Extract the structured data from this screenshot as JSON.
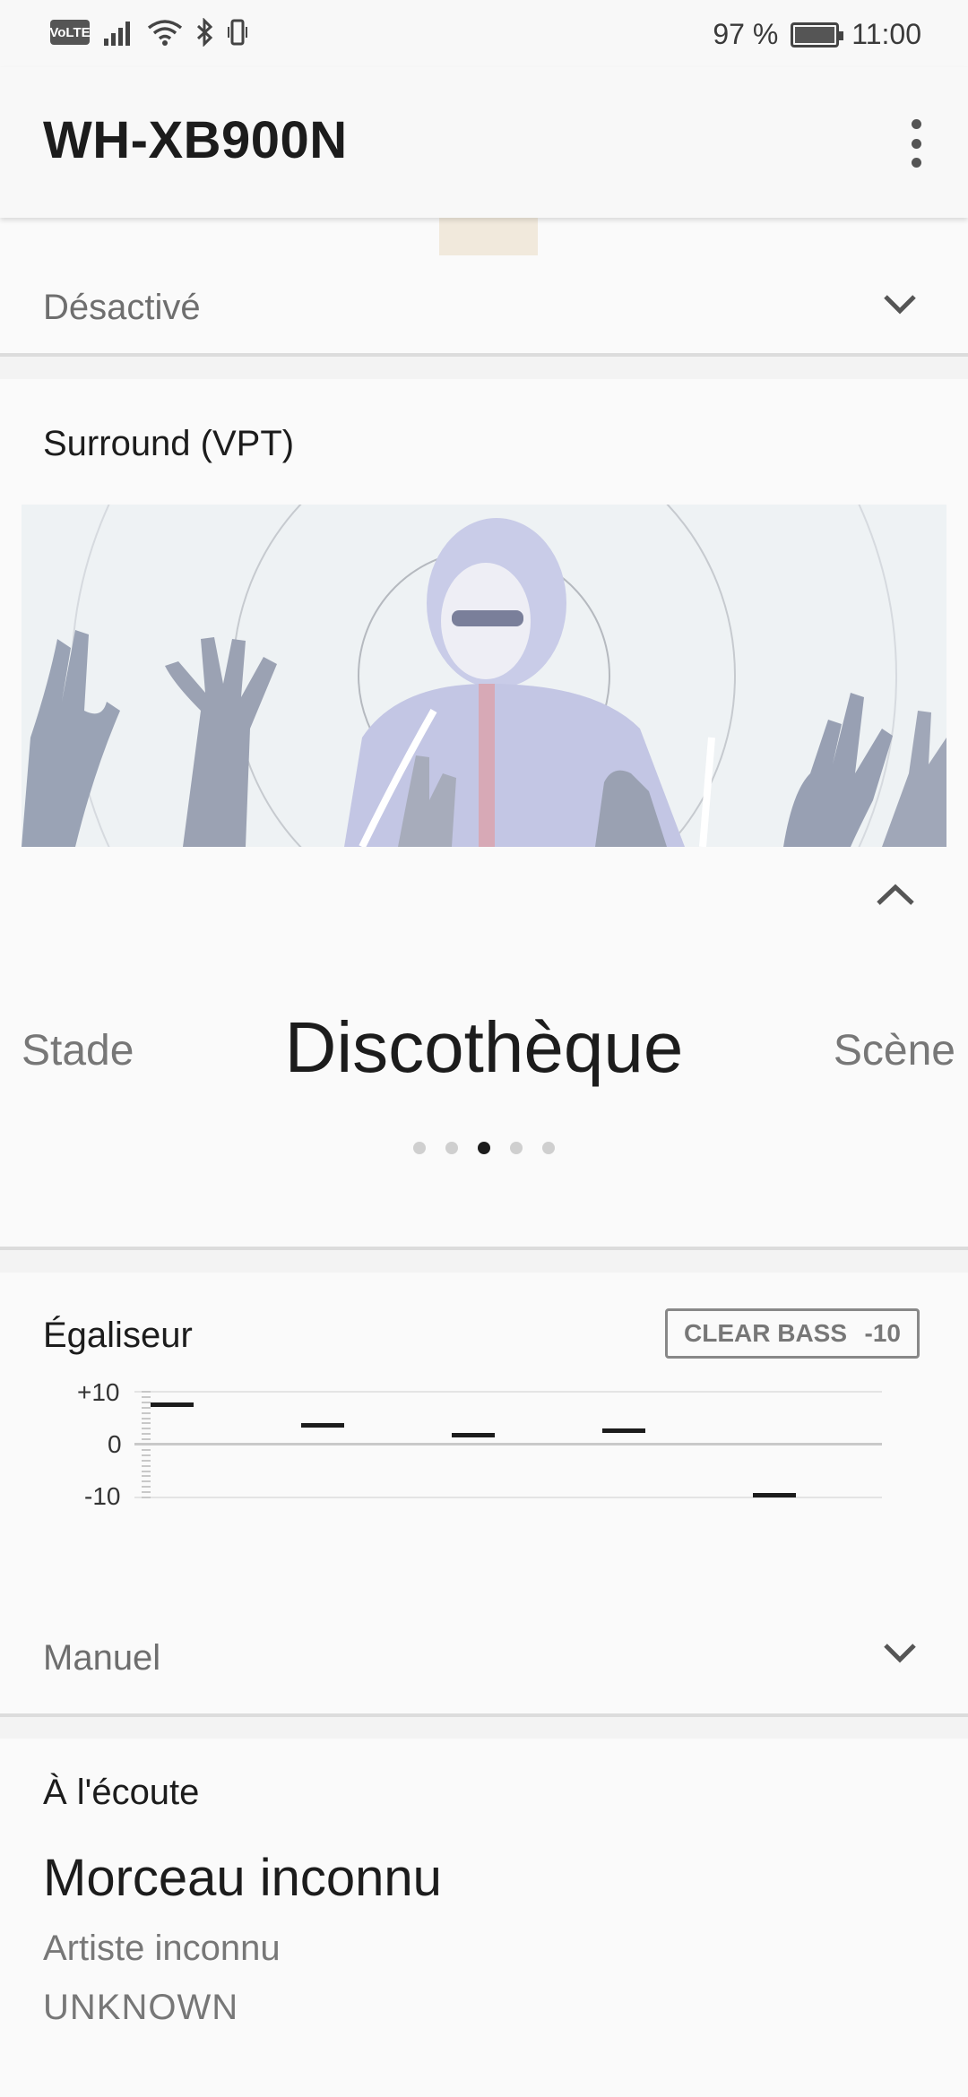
{
  "status_bar": {
    "volte": "VoLTE",
    "battery_percent": "97 %",
    "time": "11:00",
    "icons": [
      "volte-icon",
      "signal-icon",
      "wifi-icon",
      "bluetooth-icon",
      "vibrate-icon",
      "battery-icon"
    ]
  },
  "app_bar": {
    "title": "WH-XB900N",
    "menu_icon": "more-vert-icon"
  },
  "noise_card": {
    "selected_value": "Désactivé"
  },
  "surround": {
    "title": "Surround (VPT)",
    "carousel": {
      "previous": "Stade",
      "current": "Discothèque",
      "next": "Scène",
      "page_count": 5,
      "active_index": 2
    }
  },
  "equalizer": {
    "title": "Égaliseur",
    "clear_bass_label": "CLEAR BASS",
    "clear_bass_value": "-10",
    "axis_labels": {
      "top": "+10",
      "middle": "0",
      "bottom": "-10"
    },
    "bands": [
      7.5,
      3.5,
      1.5,
      2.5,
      -10
    ],
    "preset": "Manuel"
  },
  "now_playing": {
    "title": "À l'écoute",
    "track": "Morceau inconnu",
    "artist": "Artiste inconnu",
    "album": "UNKNOWN"
  },
  "colors": {
    "background": "#f3f3f3",
    "card": "#fafafa",
    "text_primary": "#1c1c1c",
    "text_secondary": "#777777"
  }
}
